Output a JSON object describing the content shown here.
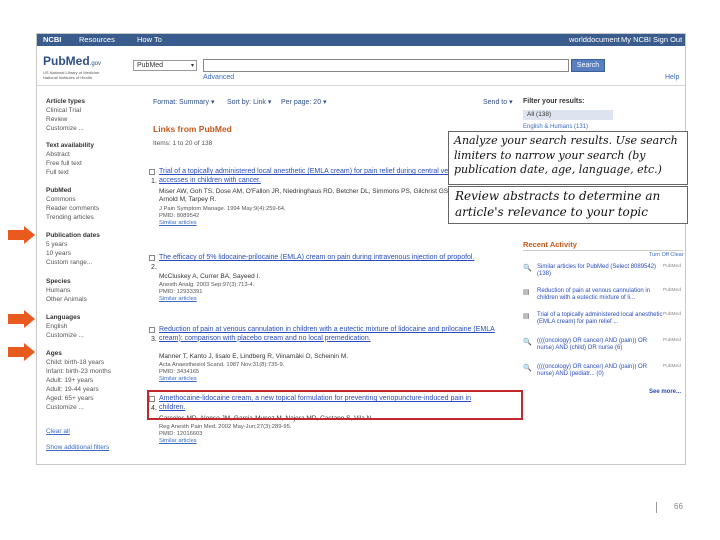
{
  "header": {
    "ncbi": "NCBI",
    "resources": "Resources",
    "howto": "How To",
    "account": "worlddocument",
    "my_ncbi": "My NCBI",
    "sign_out": "Sign Out"
  },
  "logo": {
    "text": "PubMed",
    "suffix": ".gov",
    "line1": "US National Library of Medicine",
    "line2": "National Institutes of Health"
  },
  "search": {
    "db": "PubMed",
    "button": "Search",
    "advanced": "Advanced",
    "help": "Help"
  },
  "left_filters": {
    "article_types": "Article types",
    "clinical_trial": "Clinical Trial",
    "review": "Review",
    "customize": "Customize ...",
    "text_availability": "Text availability",
    "abstract": "Abstract",
    "free_full_text": "Free full text",
    "full_text": "Full text",
    "pubmed_commons": "PubMed",
    "commons": "Commons",
    "reader_comments": "Reader comments",
    "trending_articles": "Trending articles",
    "publication_dates": "Publication dates",
    "five_years": "5 years",
    "ten_years": "10 years",
    "custom_range": "Custom range...",
    "species": "Species",
    "humans": "Humans",
    "other_animals": "Other Animals",
    "languages": "Languages",
    "english": "English",
    "customize_lang": "Customize ...",
    "ages": "Ages",
    "child_birth": "Child: birth-18 years",
    "infant": "Infant: birth-23 months",
    "adult_19": "Adult: 19+ years",
    "adult_19_44": "Adult: 19-44 years",
    "aged_65": "Aged: 65+ years",
    "customize_ages": "Customize ...",
    "clear_all": "Clear all",
    "show_additional": "Show additional filters"
  },
  "controls": {
    "format": "Format: Summary ▾",
    "sort": "Sort by: Link ▾",
    "per_page": "Per page: 20 ▾",
    "send_to": "Send to ▾"
  },
  "results": {
    "title": "Links from PubMed",
    "count": "Items: 1 to 20 of 138",
    "items": [
      {
        "num": "1.",
        "title": "Trial of a topically administered local anesthetic (EMLA cream) for pain relief during central venous port accesses in children with cancer.",
        "authors": "Miser AW, Goh TS, Dose AM, O'Fallon JR, Niedringhaus RD, Betcher DL, Simmons PS, Gilchrist GS, Burgert EO Jr, Arnold M, Tarpey R.",
        "source": "J Pain Symptom Manage. 1994 May;9(4):259-64.",
        "pmid": "PMID: 8089542",
        "similar": "Similar articles"
      },
      {
        "num": "2.",
        "title": "The efficacy of 5% lidocaine-prilocaine (EMLA) cream on pain during intravenous injection of propofol.",
        "authors": "McCluskey A, Currer BA, Sayeed I.",
        "source": "Anesth Analg. 2003 Sep;97(3):713-4.",
        "pmid": "PMID: 12933391",
        "similar": "Similar articles"
      },
      {
        "num": "3.",
        "title": "Reduction of pain at venous cannulation in children with a eutectic mixture of lidocaine and prilocaine (EMLA cream): comparison with placebo cream and no local premedication.",
        "authors": "Manner T, Kanto J, Iisalo E, Lindberg R, Viinamäki O, Scheinin M.",
        "source": "Acta Anaesthesiol Scand. 1987 Nov;31(8):735-9.",
        "pmid": "PMID: 3434165",
        "similar": "Similar articles"
      },
      {
        "num": "4.",
        "title": "Amethocaine-lidocaine cream, a new topical formulation for preventing venopuncture-induced pain in children.",
        "authors": "Carceles MD, Alonso JM, Garcia-Munoz M, Najera MD, Castano S, Vila N.",
        "source": "Reg Anesth Pain Med. 2002 May-Jun;27(3):289-95.",
        "pmid": "PMID: 12016603",
        "similar": "Similar articles"
      }
    ]
  },
  "right_panel": {
    "filter_title": "Filter your results:",
    "all": "All (138)",
    "english_full": "English & Humans (131)",
    "recent_title": "Recent Activity",
    "turn_off": "Turn Off",
    "clear": "Clear",
    "activity": [
      {
        "text": "Similar articles for PubMed (Select 8089542) (138)",
        "tag": "PubMed"
      },
      {
        "text": "Reduction of pain at venous cannulation in children with a eutectic mixture of li...",
        "tag": "PubMed"
      },
      {
        "text": "Trial of a topically administered local anesthetic (EMLA cream) for pain relief ...",
        "tag": "PubMed"
      },
      {
        "text": "((((oncology) OR cancer) AND (pain)) OR nurse) AND (child) OR nurse (6)",
        "tag": "PubMed"
      },
      {
        "text": "((((oncology) OR cancer) AND (pain)) OR nurse) AND (pediatr... (0)",
        "tag": "PubMed"
      }
    ],
    "see_more": "See more..."
  },
  "callouts": {
    "one": "Analyze your search results. Use search limiters to narrow your search (by publication date, age, language, etc.)",
    "two": "Review abstracts to determine an article's relevance to your topic"
  },
  "slide": {
    "page_number": "66"
  },
  "colors": {
    "highlight": "#c0282e",
    "arrow": "#e85a1e",
    "heading_orange": "#c65a1e",
    "link_blue": "#2a4cc0",
    "ncbi_bar": "#3a5c8c"
  }
}
